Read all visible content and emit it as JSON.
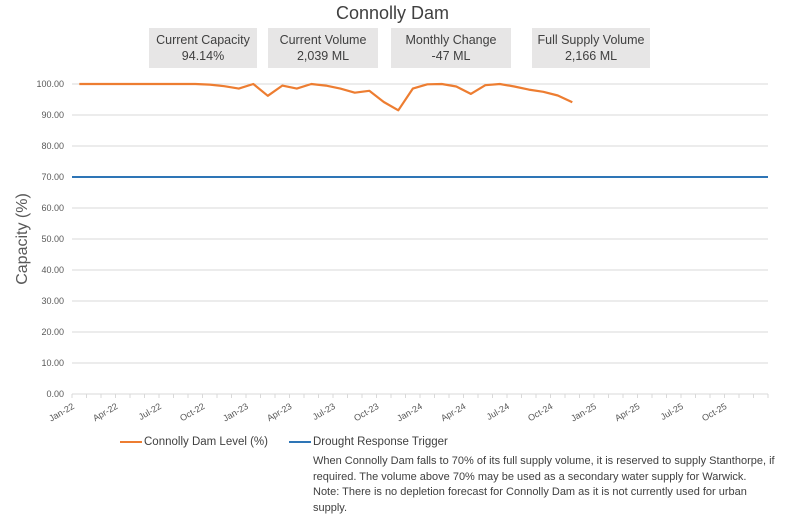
{
  "kpis": [
    {
      "label": "Current Capacity",
      "value": "94.14%"
    },
    {
      "label": "Current Volume",
      "value": "2,039 ML"
    },
    {
      "label": "Monthly Change",
      "value": "-47 ML"
    },
    {
      "label": "Full Supply Volume",
      "value": "2,166 ML"
    }
  ],
  "note": {
    "line1": "When Connolly Dam falls to 70% of its full supply volume, it is reserved to supply Stanthorpe, if",
    "line2": "required. The volume above 70% may be used as a secondary water supply for Warwick.",
    "line3": "Note: There is no depletion forecast for Connolly Dam as it is not currently used for urban supply."
  },
  "colors": {
    "level": "#ed7d31",
    "trigger": "#2e75b6",
    "grid": "#d9d9d9"
  },
  "chart_data": {
    "type": "line",
    "title": "Connolly Dam",
    "xlabel": "",
    "ylabel": "Capacity (%)",
    "ylim": [
      0,
      100
    ],
    "yticks": [
      "0.00",
      "10.00",
      "20.00",
      "30.00",
      "40.00",
      "50.00",
      "60.00",
      "70.00",
      "80.00",
      "90.00",
      "100.00"
    ],
    "x_range": [
      "Jan-22",
      "Dec-25"
    ],
    "xtick_labels": [
      "Jan-22",
      "Apr-22",
      "Jul-22",
      "Oct-22",
      "Jan-23",
      "Apr-23",
      "Jul-23",
      "Oct-23",
      "Jan-24",
      "Apr-24",
      "Jul-24",
      "Oct-24",
      "Jan-25",
      "Apr-25",
      "Jul-25",
      "Oct-25"
    ],
    "grid": true,
    "legend_position": "bottom-left",
    "series": [
      {
        "name": "Connolly Dam Level (%)",
        "x": [
          "Jan-22",
          "Feb-22",
          "Mar-22",
          "Apr-22",
          "May-22",
          "Jun-22",
          "Jul-22",
          "Aug-22",
          "Sep-22",
          "Oct-22",
          "Nov-22",
          "Dec-22",
          "Jan-23",
          "Feb-23",
          "Mar-23",
          "Apr-23",
          "May-23",
          "Jun-23",
          "Jul-23",
          "Aug-23",
          "Sep-23",
          "Oct-23",
          "Nov-23",
          "Dec-23",
          "Jan-24",
          "Feb-24",
          "Mar-24",
          "Apr-24",
          "May-24",
          "Jun-24",
          "Jul-24",
          "Aug-24",
          "Sep-24",
          "Oct-24",
          "Nov-24"
        ],
        "values": [
          100,
          100,
          100,
          100,
          100,
          100,
          100,
          100,
          100,
          99.8,
          99.3,
          98.5,
          100,
          96.2,
          99.5,
          98.5,
          100,
          99.5,
          98.5,
          97.2,
          97.8,
          94.2,
          91.5,
          98.5,
          99.9,
          100,
          99.2,
          96.8,
          99.6,
          100,
          99.2,
          98.2,
          97.5,
          96.3,
          94.14
        ]
      },
      {
        "name": "Drought Response Trigger",
        "constant": 70
      }
    ]
  }
}
